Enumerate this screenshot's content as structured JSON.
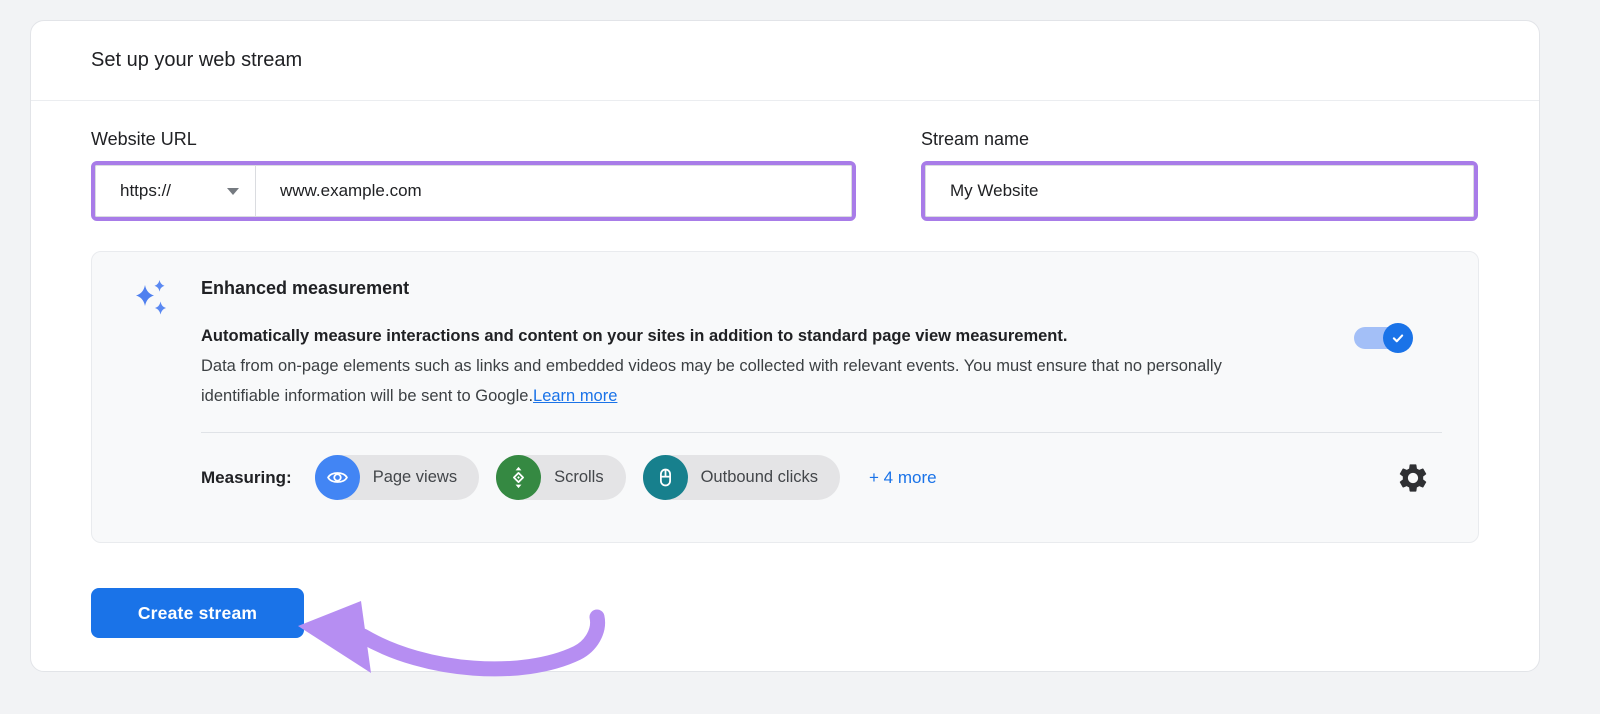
{
  "window": {
    "title": "Set up your web stream"
  },
  "form": {
    "website_url": {
      "label": "Website URL",
      "protocol": "https://",
      "value": "www.example.com"
    },
    "stream_name": {
      "label": "Stream name",
      "value": "My Website"
    }
  },
  "enhanced_measurement": {
    "title": "Enhanced measurement",
    "description_bold": "Automatically measure interactions and content on your sites in addition to standard page view measurement.",
    "description_rest": "Data from on-page elements such as links and embedded videos may be collected with relevant events. You must ensure that no personally identifiable information will be sent to Google.",
    "learn_more_label": "Learn more",
    "toggle_state": "on",
    "measuring_label": "Measuring:",
    "chips": [
      {
        "label": "Page views",
        "icon": "eye-icon",
        "circle_color": "#4285f4"
      },
      {
        "label": "Scrolls",
        "icon": "scroll-icon",
        "circle_color": "#358942"
      },
      {
        "label": "Outbound clicks",
        "icon": "mouse-icon",
        "circle_color": "#17808d"
      }
    ],
    "more_label": "+ 4 more"
  },
  "actions": {
    "create_stream_label": "Create stream"
  },
  "colors": {
    "accent_blue": "#1a73e8",
    "highlight_purple": "#a87ce8",
    "annotation_arrow_purple": "#b68ef2",
    "toggle_track": "#a3bff7",
    "panel_bg": "#f8f9fa",
    "chip_bg": "#e4e4e6"
  }
}
